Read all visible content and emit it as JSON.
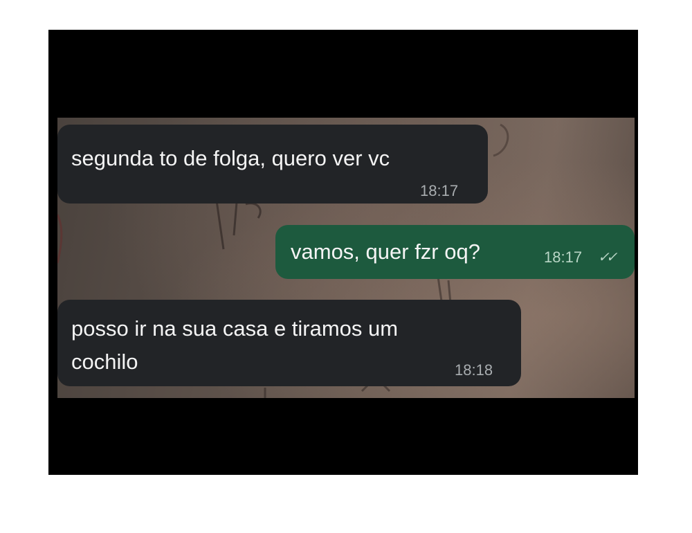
{
  "messages": [
    {
      "direction": "incoming",
      "text": "segunda to de folga, quero ver vc",
      "time": "18:17"
    },
    {
      "direction": "outgoing",
      "text": "vamos, quer fzr oq?",
      "time": "18:17",
      "status_icon": "double-check-icon"
    },
    {
      "direction": "incoming",
      "text_line1": "posso ir na sua casa e tiramos um",
      "text_line2": "cochilo",
      "time": "18:18"
    }
  ],
  "colors": {
    "incoming_bubble": "#222427",
    "outgoing_bubble": "#1d5a3e",
    "frame": "#000000",
    "page": "#ffffff"
  }
}
